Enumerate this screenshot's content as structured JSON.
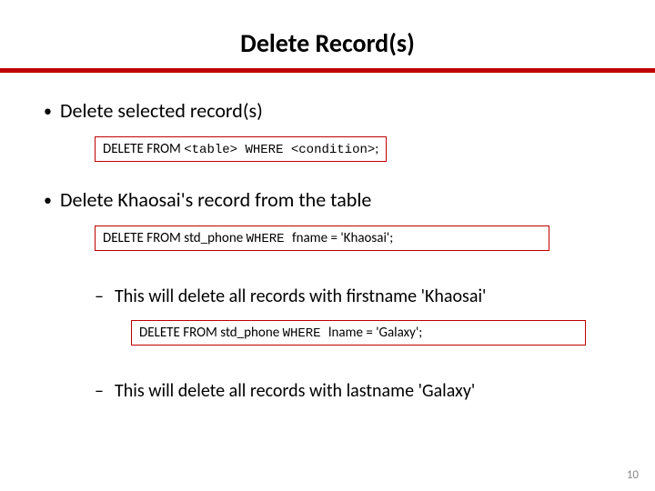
{
  "title": "Delete Record(s)",
  "bullets": {
    "b1": "Delete selected record(s)",
    "b2": "Delete Khaosai's record from the table"
  },
  "code": {
    "c1": {
      "kw1": "DELETE FROM ",
      "arg1": "<table>",
      "kw2": " WHERE ",
      "arg2": "<condition>",
      "tail": ";"
    },
    "c2": {
      "kw1": "DELETE FROM ",
      "arg1": " std_phone ",
      "kw2": " WHERE ",
      "arg2": " fname = 'Khaosai';"
    },
    "c3": {
      "kw1": "DELETE FROM ",
      "arg1": " std_phone ",
      "kw2": " WHERE ",
      "arg2": " lname = 'Galaxy';"
    }
  },
  "subs": {
    "s1": "This will delete all records with firstname 'Khaosai'",
    "s2": "This will delete all records with lastname 'Galaxy'"
  },
  "page": "10"
}
